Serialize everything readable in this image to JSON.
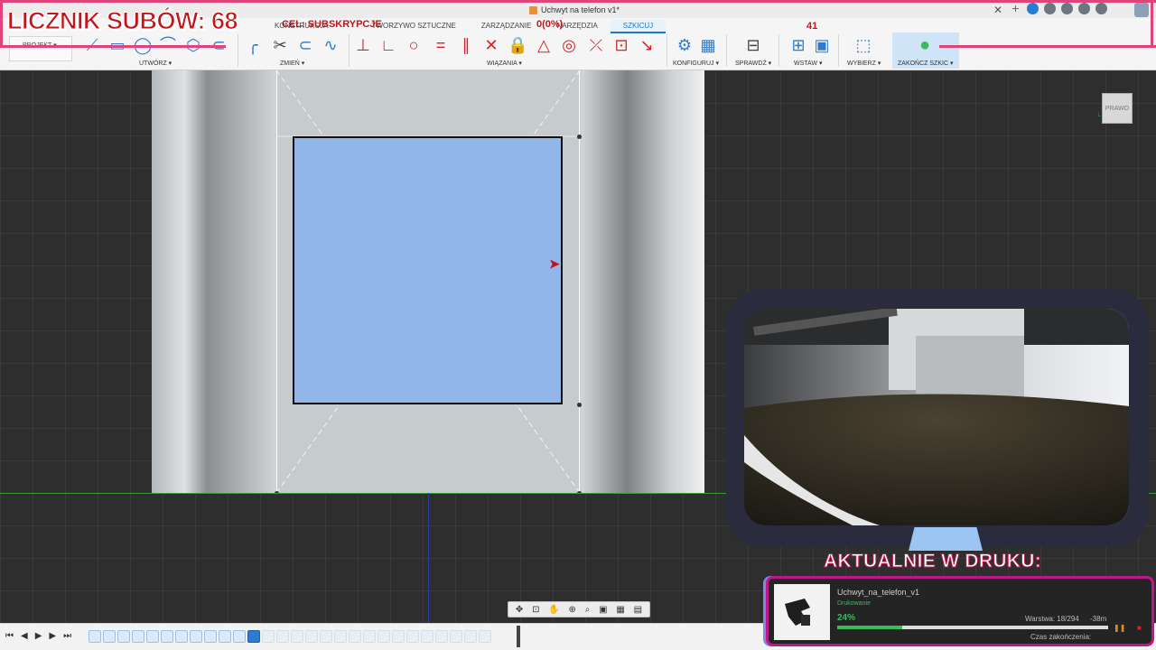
{
  "overlay": {
    "licznik": "LICZNIK SUBÓW: 68",
    "cel": "CEL: SUBSKRYPCJE",
    "cel_count": "0(0%)",
    "counter_right": "41",
    "aktualnie": "AKTUALNIE W DRUKU:"
  },
  "window": {
    "doc_title": "Uchwyt na telefon v1*"
  },
  "toolbar": {
    "projekt": "PROJEKT ▾",
    "tabs": [
      "KONSTRUKCJA",
      "TWORZYWO SZTUCZNE",
      "ZARZĄDZANIE",
      "NARZĘDZIA",
      "SZKICUJ"
    ],
    "active_tab": "SZKICUJ",
    "groups": {
      "utworz": "UTWÓRZ ▾",
      "zmien": "ZMIEŃ ▾",
      "wiazania": "WIĄZANIA ▾",
      "konfiguruj": "KONFIGURUJ ▾",
      "sprawdz": "SPRAWDŹ ▾",
      "wstaw": "WSTAW ▾",
      "wybierz": "WYBIERZ ▾",
      "zakoncz": "ZAKOŃCZ SZKIC ▾"
    }
  },
  "viewcube": {
    "face_label": "PRAWO"
  },
  "print": {
    "file_name": "Uchwyt_na_telefon_v1",
    "status": "Drukowanie",
    "percent_label": "24%",
    "progress": 0.24,
    "layer": "Warstwa: 18/294",
    "remaining": "-38m",
    "end_time_label": "Czas zakończenia:"
  },
  "colors": {
    "accent_red": "#c0161b",
    "frame_pink": "#e0447a",
    "sketch_fill": "#93b6ea",
    "progress_green": "#3cba5c",
    "active_blue": "#2b7bd1"
  }
}
